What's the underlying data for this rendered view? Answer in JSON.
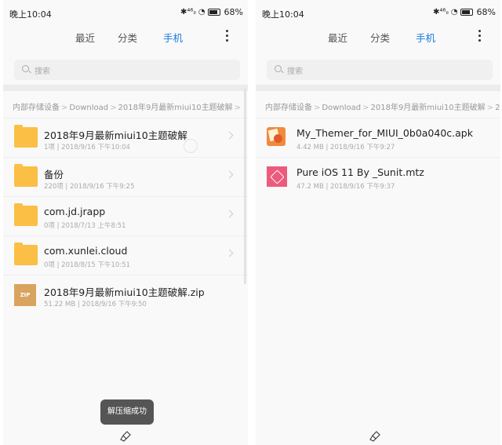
{
  "status": {
    "time": "晚上10:04",
    "signal": "✱⁴⁶ᵢₗ",
    "battery": "68%"
  },
  "tabs": {
    "recent": "最近",
    "category": "分类",
    "phone": "手机"
  },
  "search": {
    "placeholder": "搜索"
  },
  "left": {
    "breadcrumb": [
      "内部存储设备",
      "Download",
      "2018年9月最新miui10主题破解",
      ""
    ],
    "items": [
      {
        "name": "2018年9月最新miui10主题破解",
        "meta": "1项 | 2018/9/16 下午10:04",
        "type": "folder"
      },
      {
        "name": "备份",
        "meta": "220项 | 2018/9/16 下午9:25",
        "type": "folder"
      },
      {
        "name": "com.jd.jrapp",
        "meta": "0项 | 2018/7/13 上午8:51",
        "type": "folder"
      },
      {
        "name": "com.xunlei.cloud",
        "meta": "0项 | 2018/8/15 下午10:51",
        "type": "folder"
      },
      {
        "name": "2018年9月最新miui10主题破解.zip",
        "meta": "51.22 MB | 2018/9/16 下午9:50",
        "type": "zip",
        "icon_text": "ZIP"
      }
    ],
    "toast": "解压缩成功"
  },
  "right": {
    "breadcrumb": [
      "内部存储设备",
      "Download",
      "2018年9月最新miui10主题破解",
      "2"
    ],
    "items": [
      {
        "name": "My_Themer_for_MIUI_0b0a040c.apk",
        "meta": "4.42 MB | 2018/9/16 下午9:27",
        "type": "apk"
      },
      {
        "name": "Pure iOS 11 By _Sunit.mtz",
        "meta": "47.2 MB | 2018/9/16 下午9:37",
        "type": "mtz"
      }
    ]
  },
  "colors": {
    "accent": "#1a7ae0",
    "folder": "#fbbf45",
    "zip": "#d9a45e",
    "mtz": "#ec5b7d",
    "apk": "#f08a3c"
  },
  "icons": {
    "clean": "broom-icon",
    "search": "search-icon",
    "menu": "more-vertical-icon",
    "chevron": "chevron-right-icon"
  }
}
